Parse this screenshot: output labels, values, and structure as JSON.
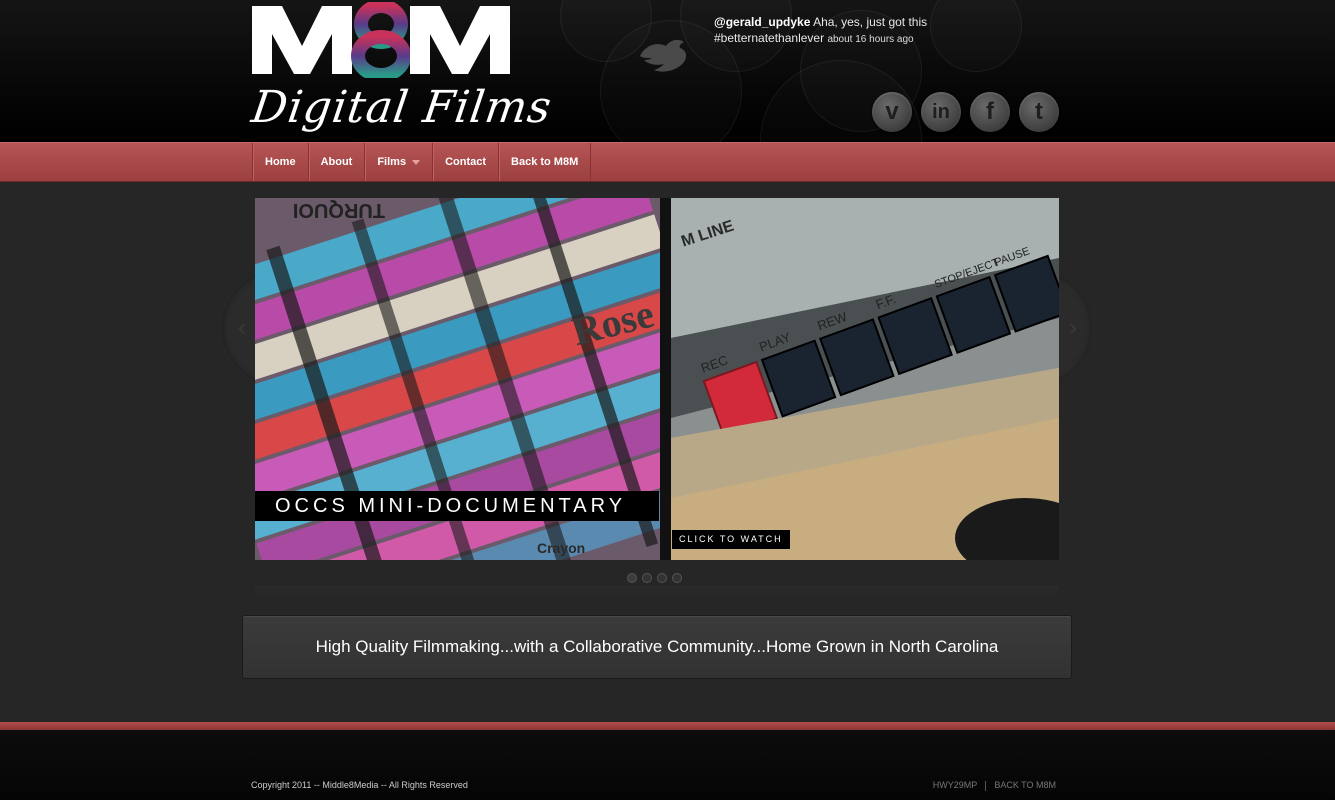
{
  "header": {
    "logo_text": "M8M",
    "logo_script": "Digital Films",
    "tweet": {
      "user": "@gerald_updyke",
      "text": "Aha, yes, just got this #betternatethanlever",
      "time": "about 16 hours ago"
    },
    "social": [
      {
        "name": "vimeo-icon",
        "glyph": "v"
      },
      {
        "name": "linkedin-icon",
        "glyph": "in"
      },
      {
        "name": "facebook-icon",
        "glyph": "f"
      },
      {
        "name": "twitter-icon",
        "glyph": "t"
      }
    ]
  },
  "nav": {
    "items": [
      "Home",
      "About",
      "Films",
      "Contact",
      "Back to M8M"
    ]
  },
  "slider": {
    "caption": "OCCS MINI-DOCUMENTARY",
    "cta": "CLICK TO WATCH",
    "prev_glyph": "‹",
    "next_glyph": "›",
    "image_labels": {
      "crayon_top": "TURQUOI",
      "crayon_brand": "Rose",
      "crayon_label": "Crayon",
      "cassette_line": "M LINE",
      "btn_rec": "REC",
      "btn_play": "PLAY",
      "btn_rew": "REW",
      "btn_ff": "F.F.",
      "btn_stop": "STOP/EJECT",
      "btn_pause": "PAUSE"
    },
    "active_dot": 0,
    "dot_count": 4
  },
  "tagline": "High Quality Filmmaking...with a Collaborative Community...Home Grown in North Carolina",
  "footer": {
    "copyright": "Copyright 2011 -- Middle8Media -- All Rights Reserved",
    "links": [
      "HWY29MP",
      "BACK TO M8M"
    ]
  },
  "colors": {
    "accent_red": "#a44848",
    "background": "#262626"
  }
}
